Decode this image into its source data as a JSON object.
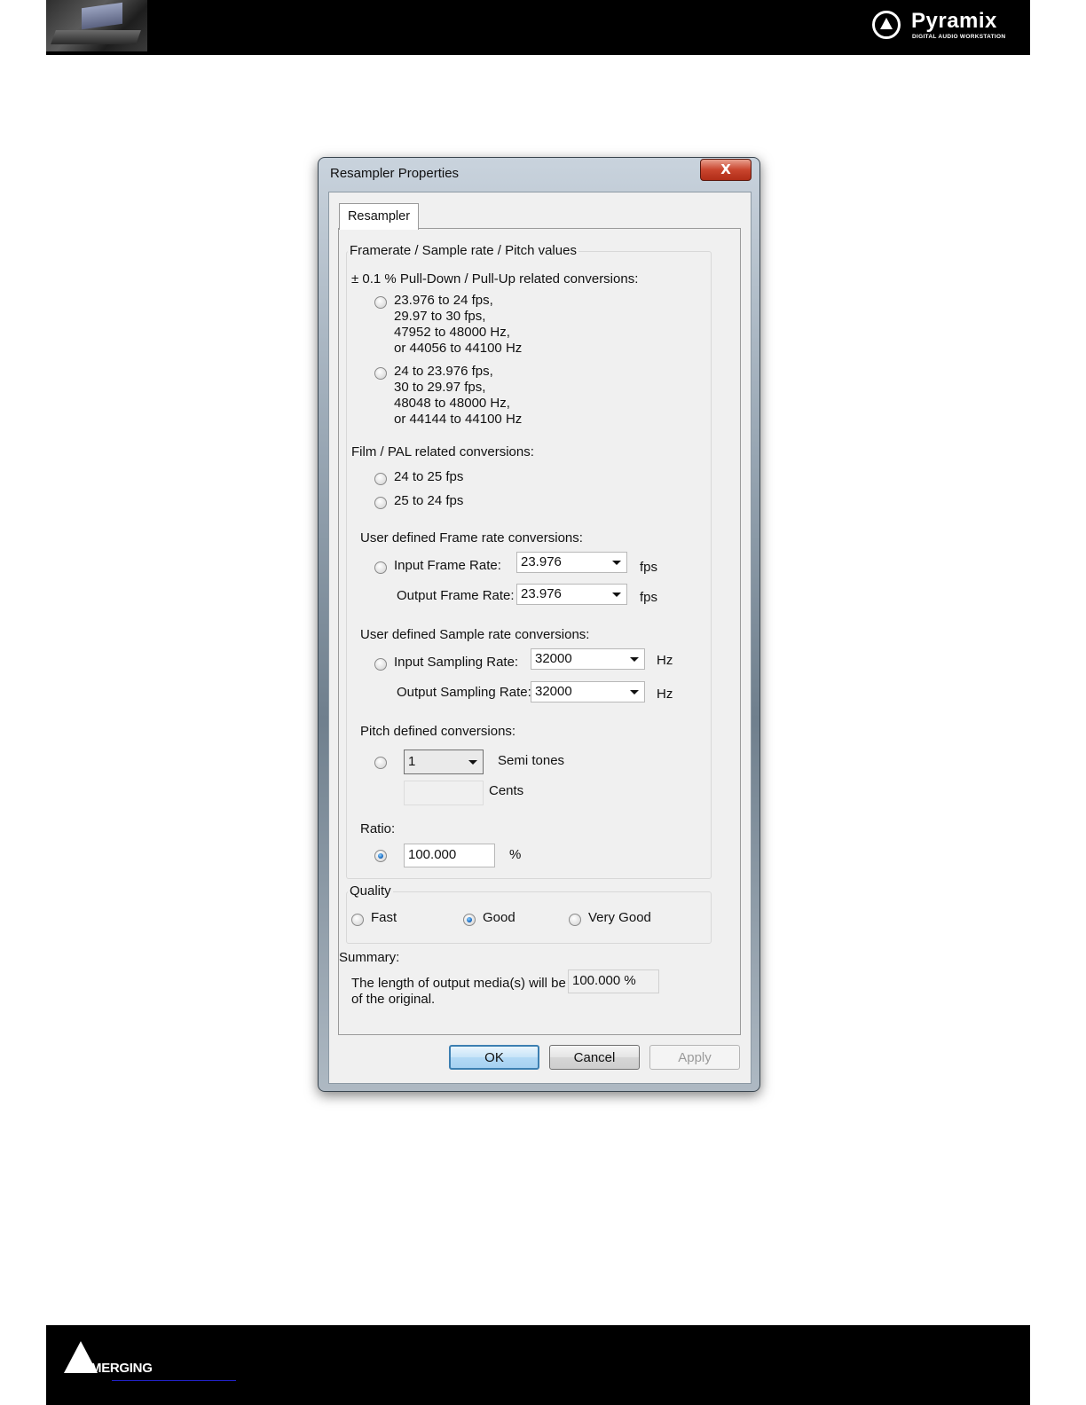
{
  "header": {
    "brand_name": "Pyramix",
    "brand_tagline": "DIGITAL AUDIO WORKSTATION"
  },
  "footer": {
    "brand_name": "MERGING"
  },
  "dialog": {
    "title": "Resampler Properties",
    "close_label": "X",
    "tab_label": "Resampler",
    "group_values_label": "Framerate / Sample rate / Pitch values",
    "pulldown_heading": "± 0.1 % Pull-Down / Pull-Up related conversions:",
    "pulldown_option1": [
      "23.976 to 24 fps,",
      "29.97 to 30 fps,",
      "47952 to 48000 Hz,",
      "or 44056 to 44100 Hz"
    ],
    "pulldown_option2": [
      "24 to 23.976 fps,",
      "30 to 29.97 fps,",
      "48048 to 48000 Hz,",
      "or 44144 to 44100 Hz"
    ],
    "film_pal_heading": "Film / PAL related conversions:",
    "film_option1": "24 to 25 fps",
    "film_option2": "25 to 24 fps",
    "frame_rate_heading": "User defined Frame rate conversions:",
    "input_frame_rate_label": "Input Frame Rate:",
    "input_frame_rate_value": "23.976",
    "output_frame_rate_label": "Output Frame Rate:",
    "output_frame_rate_value": "23.976",
    "fps_unit": "fps",
    "sample_rate_heading": "User defined Sample rate conversions:",
    "input_sampling_rate_label": "Input Sampling Rate:",
    "input_sampling_rate_value": "32000",
    "output_sampling_rate_label": "Output Sampling Rate:",
    "output_sampling_rate_value": "32000",
    "hz_unit": "Hz",
    "pitch_heading": "Pitch defined conversions:",
    "semitones_value": "1",
    "semitones_label": "Semi tones",
    "cents_value": "",
    "cents_label": "Cents",
    "ratio_heading": "Ratio:",
    "ratio_value": "100.000",
    "percent_unit": "%",
    "quality_label": "Quality",
    "quality_fast": "Fast",
    "quality_good": "Good",
    "quality_very_good": "Very Good",
    "quality_selected": "Good",
    "conversion_selected": "Ratio",
    "summary_label": "Summary:",
    "summary_line1": "The length of output media(s) will be",
    "summary_value": "100.000 %",
    "summary_line2": "of the original.",
    "ok_label": "OK",
    "cancel_label": "Cancel",
    "apply_label": "Apply"
  }
}
